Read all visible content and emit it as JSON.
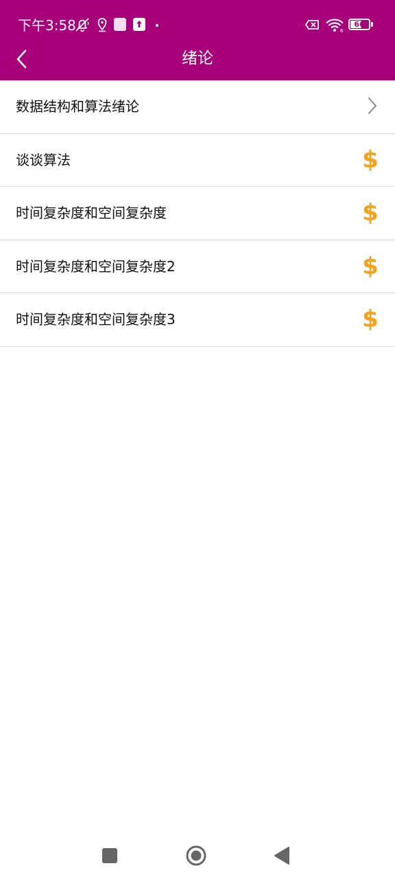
{
  "status_bar": {
    "time": "下午3:58",
    "battery_level": "66"
  },
  "toolbar": {
    "title": "绪论",
    "back_icon": "chevron-left-icon"
  },
  "list": {
    "items": [
      {
        "label": "数据结构和算法绪论",
        "trailing": "chevron-right-icon"
      },
      {
        "label": "谈谈算法",
        "trailing": "dollar-icon"
      },
      {
        "label": "时间复杂度和空间复杂度",
        "trailing": "dollar-icon"
      },
      {
        "label": "时间复杂度和空间复杂度2",
        "trailing": "dollar-icon"
      },
      {
        "label": "时间复杂度和空间复杂度3",
        "trailing": "dollar-icon"
      }
    ]
  },
  "navigation_bar": {
    "buttons": [
      "recents-icon",
      "home-icon",
      "back-triangle-icon"
    ]
  },
  "colors": {
    "primary": "#A8007A",
    "coin": "#F5A21B",
    "text": "#111111",
    "divider": "#DCDCDC",
    "chevron": "#888888",
    "nav_icon": "#666666"
  },
  "glyphs": {
    "dollar": "$"
  }
}
